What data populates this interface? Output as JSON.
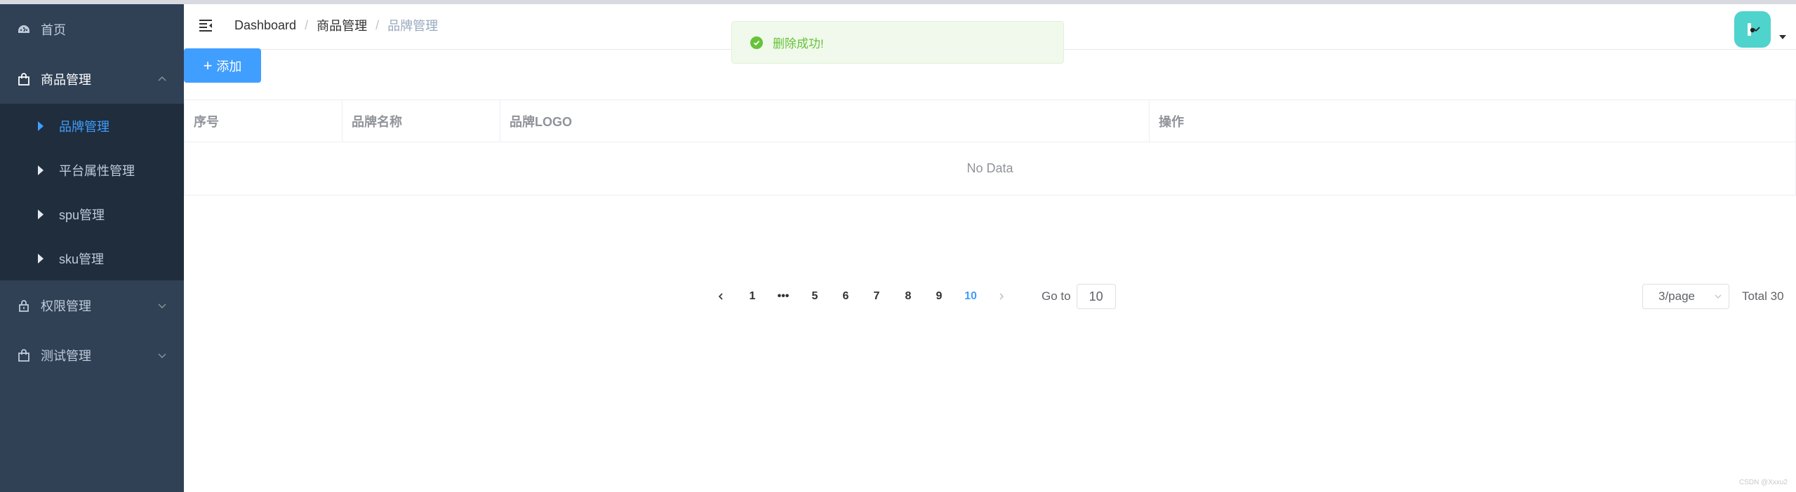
{
  "sidebar": {
    "home": {
      "label": "首页",
      "icon": "dashboard-icon"
    },
    "goods": {
      "label": "商品管理",
      "icon": "shopping-bag-icon",
      "children": [
        {
          "label": "品牌管理"
        },
        {
          "label": "平台属性管理"
        },
        {
          "label": "spu管理"
        },
        {
          "label": "sku管理"
        }
      ]
    },
    "permission": {
      "label": "权限管理",
      "icon": "lock-icon"
    },
    "test": {
      "label": "测试管理",
      "icon": "shopping-bag-icon"
    }
  },
  "header": {
    "breadcrumb": [
      "Dashboard",
      "商品管理",
      "品牌管理"
    ],
    "separator": "/"
  },
  "toast": {
    "message": "删除成功!",
    "type": "success"
  },
  "toolbar": {
    "add_label": "添加"
  },
  "table": {
    "columns": [
      "序号",
      "品牌名称",
      "品牌LOGO",
      "操作"
    ],
    "empty_text": "No Data"
  },
  "pagination": {
    "pages": [
      "1",
      "•••",
      "5",
      "6",
      "7",
      "8",
      "9",
      "10"
    ],
    "current_page": "10",
    "goto_label": "Go to",
    "goto_value": "10",
    "page_size": "3/page",
    "total": "Total 30"
  },
  "watermark": "CSDN @Xxxu2",
  "colors": {
    "sidebar_bg": "#304156",
    "submenu_bg": "#1f2d3d",
    "accent": "#409eff",
    "success": "#67c23a"
  }
}
